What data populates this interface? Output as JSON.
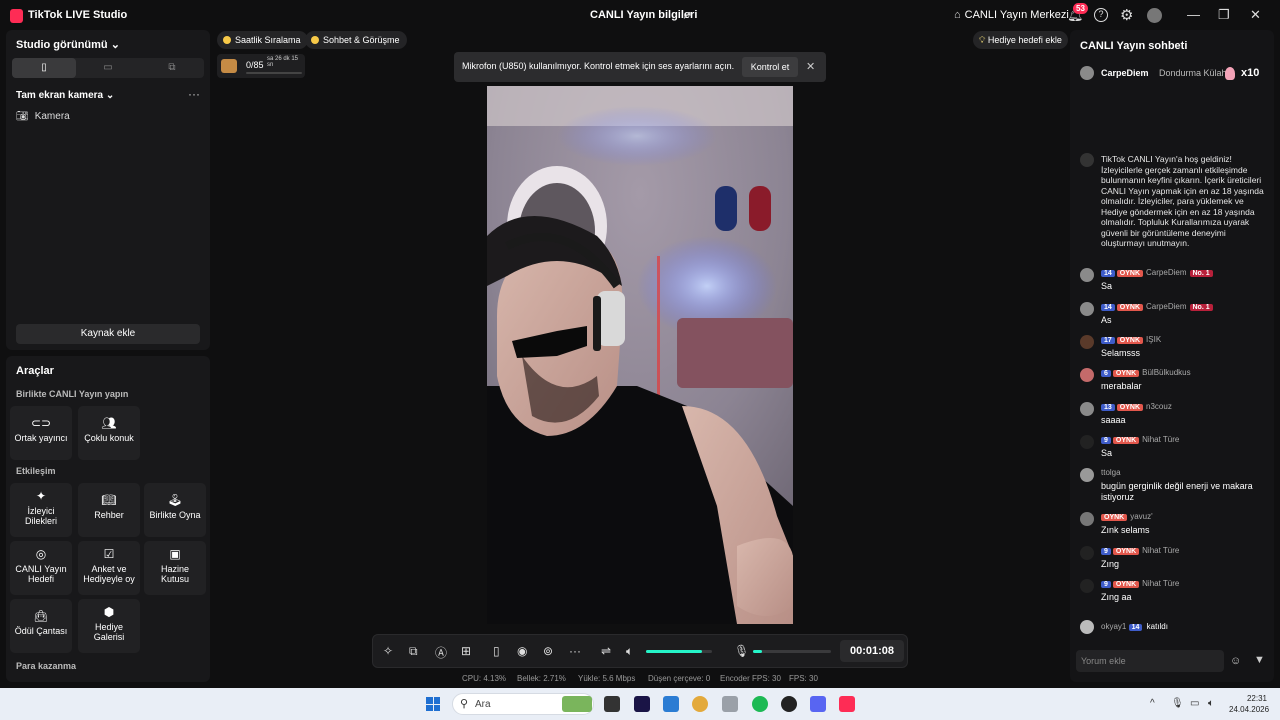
{
  "window": {
    "app_name": "TikTok LIVE Studio",
    "title": "CANLI Yayın bilgileri",
    "live_center": "CANLI Yayın Merkezi",
    "notification_count": "53"
  },
  "studio": {
    "heading": "Studio görünümü",
    "scene_label": "Tam ekran kamera",
    "source_label": "Kamera",
    "add_source": "Kaynak ekle"
  },
  "tools": {
    "heading": "Araçlar",
    "section_live_together": "Birlikte CANLI Yayın yapın",
    "section_engagement": "Etkileşim",
    "section_monetize": "Para kazanma",
    "co_host": "Ortak yayıncı",
    "multi_guest": "Çoklu konuk",
    "viewer_requests": "İzleyici Dilekleri",
    "guide": "Rehber",
    "play_together": "Birlikte Oyna",
    "live_goal": "CANLI Yayın Hedefi",
    "poll": "Anket ve Hediyeyle oy",
    "treasure": "Hazine Kutusu",
    "reward_bag": "Ödül Çantası",
    "gift_gallery": "Hediye Galerisi"
  },
  "stage": {
    "hourly_rank": "Saatlik Sıralama",
    "chat_match": "Sohbet & Görüşme",
    "gift_goal": "Hediye hedefi ekle",
    "goal_progress": "0/85",
    "goal_progress_fraction": 0.0,
    "goal_time": "sa 26 dk 15 sn",
    "toast_message": "Mikrofon (U850) kullanılmıyor. Kontrol etmek için ses ayarlarını açın.",
    "toast_button": "Kontrol et",
    "timer": "00:01:08",
    "volume_level": 0.85,
    "mic_level": 0.12
  },
  "stats": {
    "cpu": "CPU:  4.13%",
    "memory": "Bellek:  2.71%",
    "upload": "Yükle:  5.6 Mbps",
    "dropped": "Düşen çerçeve:  0",
    "encoder_fps": "Encoder FPS:  30",
    "fps": "FPS:  30"
  },
  "chat": {
    "heading": "CANLI Yayın sohbeti",
    "gift_user": "CarpeDiem",
    "gift_name": "Dondurma Külahı",
    "gift_count": "x10",
    "welcome": "TikTok CANLI Yayın'a hoş geldiniz! İzleyicilerle gerçek zamanlı etkileşimde bulunmanın keyfini çıkarın. İçerik üreticileri CANLI Yayın yapmak için en az 18 yaşında olmalıdır. İzleyiciler, para yüklemek ve Hediye göndermek için en az 18 yaşında olmalıdır. Topluluk Kurallarımıza uyarak güvenli bir görüntüleme deneyimi oluşturmayı unutmayın.",
    "fan_badge": "OYNK",
    "rank_badge": "No. 1",
    "messages": [
      {
        "level": "14",
        "user": "CarpeDiem",
        "text": "Sa"
      },
      {
        "level": "14",
        "user": "CarpeDiem",
        "text": "As"
      },
      {
        "level": "17",
        "user": "IŞIK",
        "text": "Selamsss"
      },
      {
        "level": "6",
        "user": "BülBülkudkus",
        "text": "merabalar"
      },
      {
        "level": "13",
        "user": "n3couz",
        "text": "saaaa"
      },
      {
        "level": "9",
        "user": "Nihat Türe",
        "text": "Sa"
      },
      {
        "level": "",
        "user": "ttolga",
        "text": "bugün gerginlik değil enerji ve makara istiyoruz"
      },
      {
        "level": "",
        "user": "yavuz'",
        "text": "Zınk selams"
      },
      {
        "level": "9",
        "user": "Nihat Türe",
        "text": "Zıng"
      },
      {
        "level": "9",
        "user": "Nihat Türe",
        "text": "Zıng aa"
      }
    ],
    "joined_user": "okyay1",
    "joined_level": "14",
    "joined_text": "katıldı",
    "comment_placeholder": "Yorum ekle"
  },
  "taskbar": {
    "search": "Ara",
    "time": "22:31",
    "date": "24.04.2026"
  }
}
